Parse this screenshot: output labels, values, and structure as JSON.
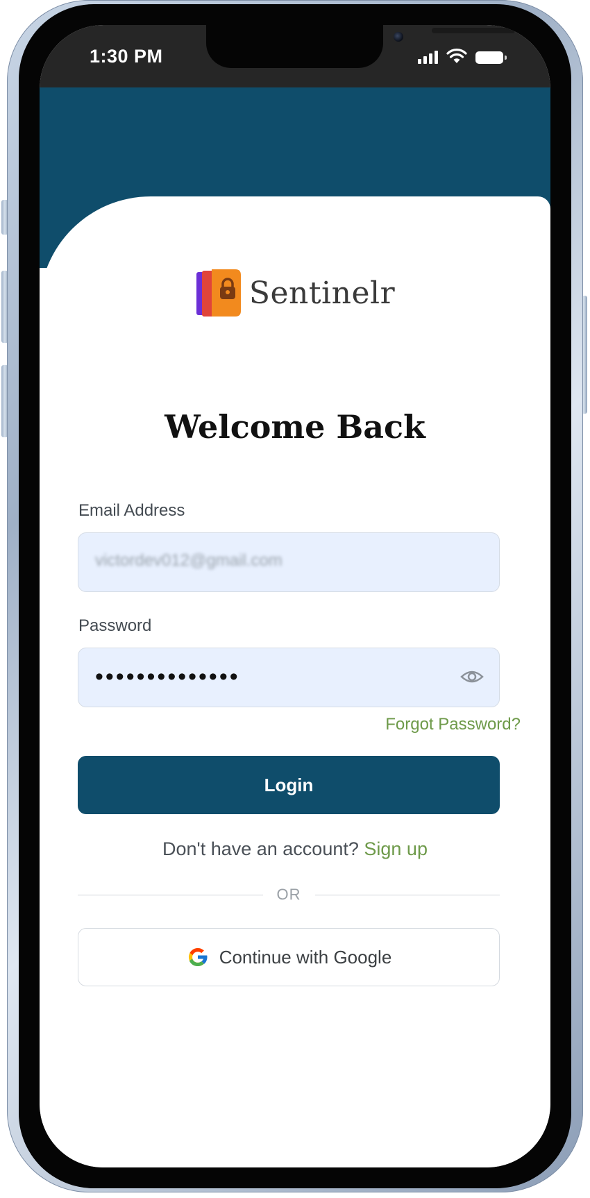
{
  "status_bar": {
    "time": "1:30 PM",
    "icons": [
      "cellular-signal-icon",
      "wifi-icon",
      "battery-icon"
    ]
  },
  "brand": {
    "name": "Sentinelr",
    "logo_icon": "padlock-book-icon",
    "colors": {
      "logo_orange": "#f28a1e",
      "logo_purple": "#6b2fd6",
      "logo_red": "#e0443a"
    }
  },
  "login": {
    "title": "Welcome Back",
    "email_label": "Email Address",
    "email_value": "victordev012@gmail.com",
    "password_label": "Password",
    "password_value": "••••••••••••••",
    "password_toggle_icon": "eye-icon",
    "forgot_password": "Forgot Password?",
    "login_button": "Login",
    "no_account_text": "Don't have an account?",
    "sign_up_link": "Sign up",
    "divider_text": "OR",
    "google_button": "Continue with Google",
    "google_icon": "google-icon"
  },
  "theme": {
    "primary": "#0f4d6b",
    "link_green": "#6e9a4a",
    "input_bg": "#e8f0fe"
  }
}
